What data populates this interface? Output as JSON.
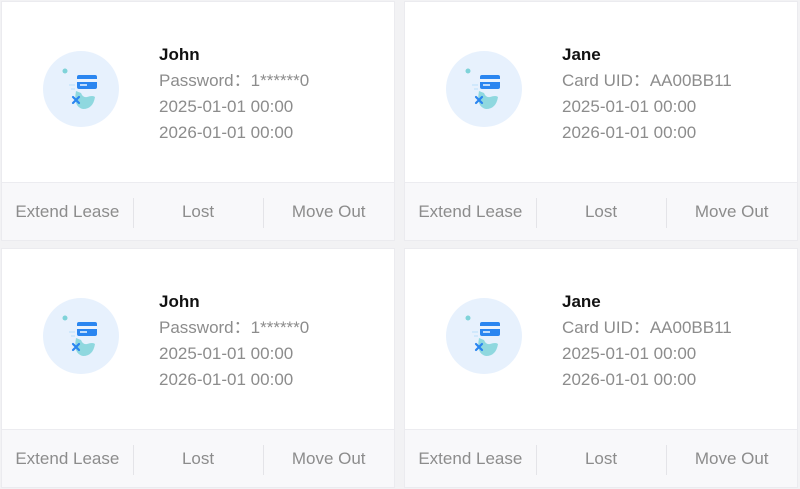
{
  "cards": [
    {
      "name": "John",
      "credential": "Password：1******0",
      "start": "2025-01-01 00:00",
      "end": "2026-01-01 00:00",
      "actions": {
        "extend": "Extend Lease",
        "lost": "Lost",
        "move_out": "Move Out"
      }
    },
    {
      "name": "Jane",
      "credential": "Card UID：AA00BB11",
      "start": "2025-01-01 00:00",
      "end": "2026-01-01 00:00",
      "actions": {
        "extend": "Extend Lease",
        "lost": "Lost",
        "move_out": "Move Out"
      }
    },
    {
      "name": "John",
      "credential": "Password：1******0",
      "start": "2025-01-01 00:00",
      "end": "2026-01-01 00:00",
      "actions": {
        "extend": "Extend Lease",
        "lost": "Lost",
        "move_out": "Move Out"
      }
    },
    {
      "name": "Jane",
      "credential": "Card UID：AA00BB11",
      "start": "2025-01-01 00:00",
      "end": "2026-01-01 00:00",
      "actions": {
        "extend": "Extend Lease",
        "lost": "Lost",
        "move_out": "Move Out"
      }
    }
  ],
  "icon": "card-credential-icon",
  "colors": {
    "icon_bg": "#e7f1fd",
    "card_blue": "#2b86f0",
    "teal": "#7fd3d9",
    "text_muted": "#8c8c8c",
    "text_dark": "#111111"
  }
}
